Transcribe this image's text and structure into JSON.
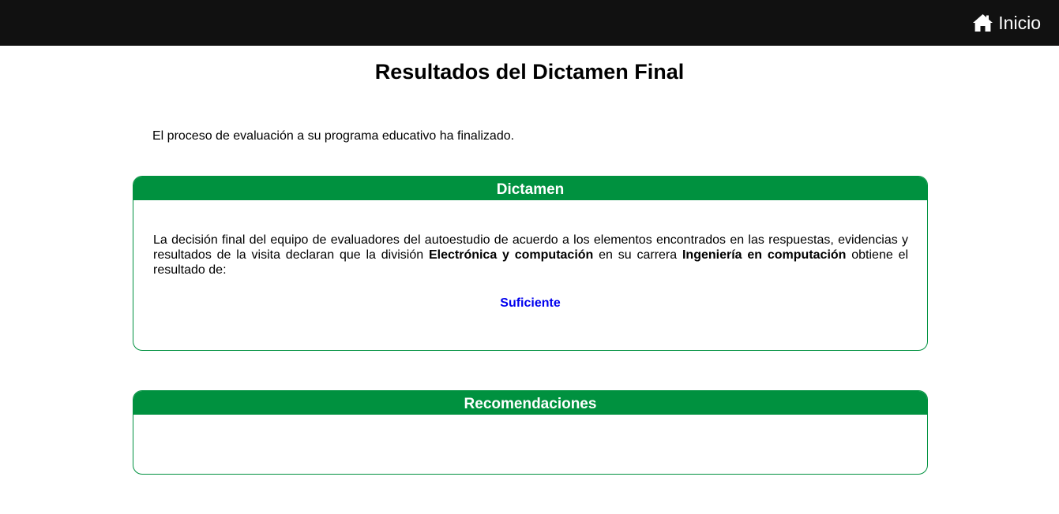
{
  "nav": {
    "home_label": "Inicio",
    "home_icon": "home-icon"
  },
  "page": {
    "title": "Resultados del Dictamen Final",
    "intro": "El proceso de evaluación a su programa educativo ha finalizado."
  },
  "dictamen": {
    "header": "Dictamen",
    "text_part1": "La decisión final del equipo de evaluadores del autoestudio de acuerdo a los elementos encontrados en las respuestas, evidencias y resultados de la visita declaran que la división ",
    "division": "Electrónica y computación",
    "text_part2": " en su carrera ",
    "carrera": "Ingeniería en computación",
    "text_part3": " obtiene el resultado de:",
    "resultado": "Suficiente"
  },
  "recomendaciones": {
    "header": "Recomendaciones"
  },
  "colors": {
    "topbar": "#111111",
    "accent_green": "#00913f",
    "result_blue": "#0000ee"
  }
}
